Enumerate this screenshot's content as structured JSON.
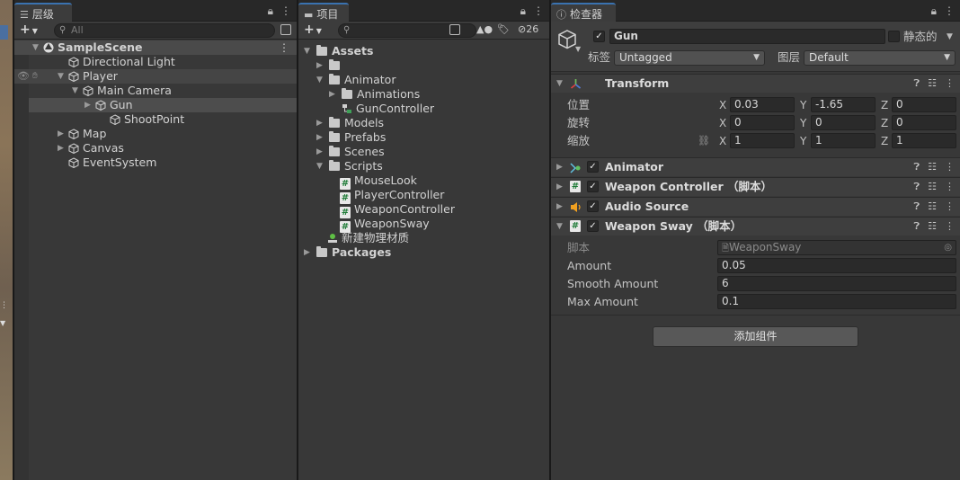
{
  "hierarchy": {
    "tab_label": "层级",
    "search_placeholder": "All",
    "scene": "SampleScene",
    "items": [
      {
        "label": "Directional Light"
      },
      {
        "label": "Player"
      },
      {
        "label": "Main Camera"
      },
      {
        "label": "Gun"
      },
      {
        "label": "ShootPoint"
      },
      {
        "label": "Map"
      },
      {
        "label": "Canvas"
      },
      {
        "label": "EventSystem"
      }
    ]
  },
  "project": {
    "tab_label": "项目",
    "hidden_count": "26",
    "items": [
      {
        "label": "Assets"
      },
      {
        "label": ""
      },
      {
        "label": "Animator"
      },
      {
        "label": "Animations"
      },
      {
        "label": "GunController"
      },
      {
        "label": "Models"
      },
      {
        "label": "Prefabs"
      },
      {
        "label": "Scenes"
      },
      {
        "label": "Scripts"
      },
      {
        "label": "MouseLook"
      },
      {
        "label": "PlayerController"
      },
      {
        "label": "WeaponController"
      },
      {
        "label": "WeaponSway"
      },
      {
        "label": "新建物理材质"
      },
      {
        "label": "Packages"
      }
    ]
  },
  "inspector": {
    "tab_label": "检查器",
    "object_name": "Gun",
    "static_label": "静态的",
    "tag_label": "标签",
    "tag_value": "Untagged",
    "layer_label": "图层",
    "layer_value": "Default",
    "transform": {
      "title": "Transform",
      "position_label": "位置",
      "rotation_label": "旋转",
      "scale_label": "缩放",
      "axis_x": "X",
      "axis_y": "Y",
      "axis_z": "Z",
      "position": {
        "x": "0.03",
        "y": "-1.65",
        "z": "0"
      },
      "rotation": {
        "x": "0",
        "y": "0",
        "z": "0"
      },
      "scale": {
        "x": "1",
        "y": "1",
        "z": "1"
      }
    },
    "components": {
      "animator": "Animator",
      "weapon_controller": "Weapon Controller （脚本）",
      "audio_source": "Audio Source",
      "weapon_sway": "Weapon Sway （脚本）"
    },
    "weapon_sway": {
      "script_label": "脚本",
      "script_value": "WeaponSway",
      "amount_label": "Amount",
      "amount_value": "0.05",
      "smooth_label": "Smooth Amount",
      "smooth_value": "6",
      "max_label": "Max Amount",
      "max_value": "0.1"
    },
    "add_component_label": "添加组件"
  },
  "colors": {
    "accent": "#3a72b0",
    "annotation_arrow": "#e02020",
    "hash_icon": "#1c7a35",
    "audio_icon": "#f0a020"
  }
}
